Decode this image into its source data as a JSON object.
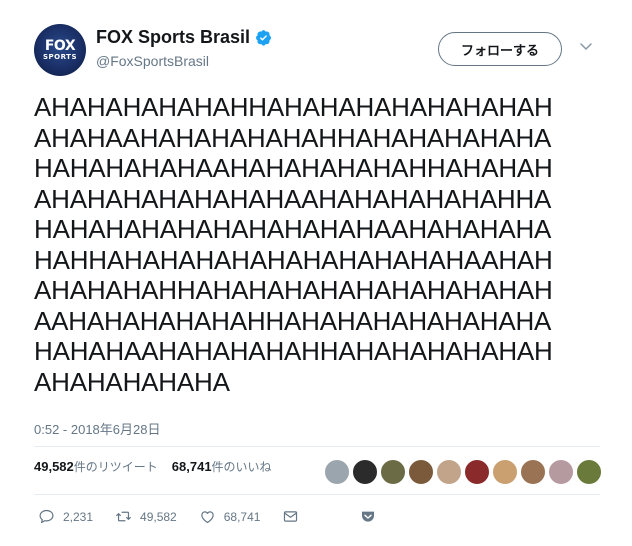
{
  "account": {
    "display_name": "FOX Sports Brasil",
    "handle": "@FoxSportsBrasil",
    "avatar_text": "FOX",
    "avatar_subtext": "SPORTS",
    "verified": true
  },
  "follow_button": {
    "label": "フォローする"
  },
  "tweet": {
    "lines": [
      "AHAHAHAHAHAHHAHAHAHAHAHAHAHAH",
      "AHAHAAHAHAHAHAHAHHAHAHAHAHAHA",
      "HAHAHAHAHAAHAHAHAHAHAHHAHAHAH",
      "AHAHAHAHAHAHAHAAHAHAHAHAHAHHA",
      "HAHAHAHAHAHAHAHAHAHAAHAHAHAHA",
      "HAHHAHAHAHAHAHAHAHAHAHAHAAHAH",
      "AHAHAHAHHAHAHAHAHAHAHAHAHAHAH",
      "AAHAHAHAHAHAHHAHAHAHAHAHAHAHA",
      "HAHAHAAHAHAHAHAHHAHAHAHAHAHAH",
      "AHAHAHAHAHA"
    ],
    "timestamp": "0:52 - 2018年6月28日"
  },
  "stats": {
    "retweets_count": "49,582",
    "retweets_label": "件のリツイート",
    "likes_count": "68,741",
    "likes_label": "件のいいね"
  },
  "liker_avatars": [
    "#9aa5ad",
    "#2b2b2b",
    "#6b6b45",
    "#7a5a3a",
    "#c2a48a",
    "#8a2a2a",
    "#caa070",
    "#9a7355",
    "#b59aa0",
    "#6a7a3a"
  ],
  "actions": {
    "reply_count": "2,231",
    "retweet_count": "49,582",
    "like_count": "68,741"
  },
  "colors": {
    "accent": "#1da1f2",
    "muted": "#657786",
    "text": "#14171a"
  }
}
